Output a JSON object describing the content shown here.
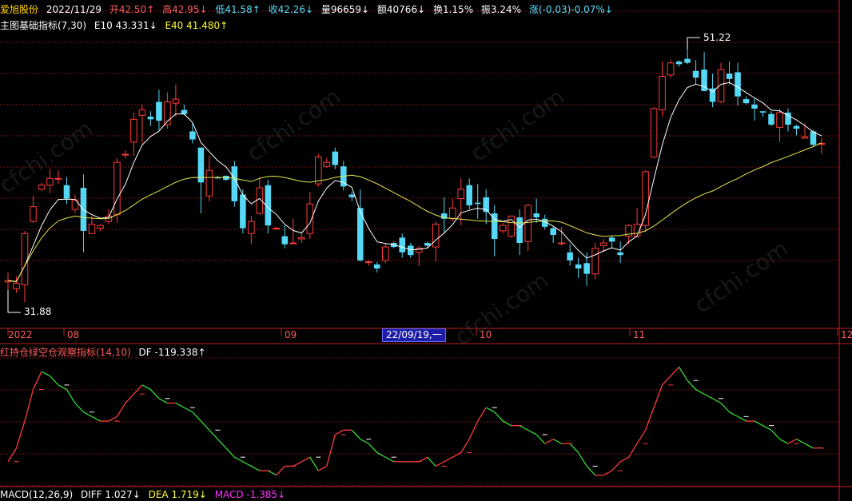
{
  "header": {
    "stock_name": "爱旭股份",
    "date": "2022/11/29",
    "open": "开42.50↑",
    "high": "高42.95↓",
    "low": "低41.58↑",
    "close": "收42.26↓",
    "volume": "量96659↓",
    "amount": "额40766↓",
    "turnover": "换1.15%",
    "amplitude": "振3.24%",
    "change": "涨(-0.03)-0.07%↓"
  },
  "indicator": {
    "name": "主图基础指标(7,30)",
    "e10": "E10 43.331↓",
    "e40": "E40 41.480↑"
  },
  "price_markers": {
    "high": "51.22",
    "low": "31.88"
  },
  "x_axis": {
    "labels": [
      "2022",
      "08",
      "09",
      "10",
      "11",
      "12"
    ],
    "crosshair_date": "22/09/19,一"
  },
  "sub_indicator": {
    "name": "红持仓绿空仓观察指标(14,10)",
    "df": "DF -119.338↑"
  },
  "macd": {
    "name": "MACD(12,26,9)",
    "diff": "DIFF 1.027↓",
    "dea": "DEA 1.719↓",
    "macd": "MACD -1.385↓"
  },
  "watermark_text": "cfchi.com",
  "colors": {
    "up": "#ff3b3b",
    "down": "#54d8f5",
    "ma_short": "#ffffff",
    "ma_long": "#e6e64a",
    "grid": "#7a1010",
    "axis": "#c02020"
  },
  "chart_data": {
    "type": "candlestick",
    "candles": [
      {
        "o": 33.9,
        "h": 34.6,
        "l": 33.3,
        "c": 34.0
      },
      {
        "o": 33.4,
        "h": 34.3,
        "l": 33.1,
        "c": 33.8
      },
      {
        "o": 33.7,
        "h": 37.7,
        "l": 32.4,
        "c": 37.5
      },
      {
        "o": 38.4,
        "h": 40.3,
        "l": 38.3,
        "c": 39.5
      },
      {
        "o": 40.8,
        "h": 41.3,
        "l": 40.7,
        "c": 41.1
      },
      {
        "o": 41.1,
        "h": 42.3,
        "l": 40.5,
        "c": 41.6
      },
      {
        "o": 41.6,
        "h": 42.2,
        "l": 41.2,
        "c": 41.6
      },
      {
        "o": 41.1,
        "h": 41.7,
        "l": 39.7,
        "c": 40.1
      },
      {
        "o": 39.3,
        "h": 40.4,
        "l": 39.0,
        "c": 40.0
      },
      {
        "o": 40.9,
        "h": 41.9,
        "l": 36.1,
        "c": 37.7
      },
      {
        "o": 37.5,
        "h": 38.8,
        "l": 37.5,
        "c": 38.2
      },
      {
        "o": 37.9,
        "h": 38.2,
        "l": 37.7,
        "c": 38.1
      },
      {
        "o": 38.4,
        "h": 39.3,
        "l": 38.2,
        "c": 38.8
      },
      {
        "o": 38.9,
        "h": 43.1,
        "l": 38.3,
        "c": 42.8
      },
      {
        "o": 43.4,
        "h": 43.7,
        "l": 43.1,
        "c": 43.4
      },
      {
        "o": 44.3,
        "h": 46.5,
        "l": 43.3,
        "c": 46.0
      },
      {
        "o": 46.3,
        "h": 47.1,
        "l": 44.2,
        "c": 46.7
      },
      {
        "o": 46.2,
        "h": 46.6,
        "l": 45.5,
        "c": 46.0
      },
      {
        "o": 47.3,
        "h": 48.2,
        "l": 45.2,
        "c": 45.9
      },
      {
        "o": 45.6,
        "h": 48.0,
        "l": 45.3,
        "c": 47.3
      },
      {
        "o": 47.2,
        "h": 48.6,
        "l": 46.2,
        "c": 47.5
      },
      {
        "o": 46.7,
        "h": 47.1,
        "l": 46.3,
        "c": 46.4
      },
      {
        "o": 45.1,
        "h": 45.7,
        "l": 44.2,
        "c": 44.5
      },
      {
        "o": 43.9,
        "h": 43.9,
        "l": 39.0,
        "c": 41.3
      },
      {
        "o": 40.3,
        "h": 43.3,
        "l": 39.9,
        "c": 42.2
      },
      {
        "o": 41.7,
        "h": 41.8,
        "l": 41.6,
        "c": 41.6
      },
      {
        "o": 41.8,
        "h": 41.8,
        "l": 41.4,
        "c": 41.5
      },
      {
        "o": 42.5,
        "h": 42.9,
        "l": 39.5,
        "c": 39.9
      },
      {
        "o": 40.4,
        "h": 40.8,
        "l": 37.5,
        "c": 37.9
      },
      {
        "o": 37.5,
        "h": 38.8,
        "l": 36.7,
        "c": 38.4
      },
      {
        "o": 39.0,
        "h": 41.7,
        "l": 38.9,
        "c": 40.9
      },
      {
        "o": 41.1,
        "h": 41.5,
        "l": 37.5,
        "c": 38.1
      },
      {
        "o": 37.9,
        "h": 38.0,
        "l": 37.8,
        "c": 37.9
      },
      {
        "o": 37.3,
        "h": 38.1,
        "l": 36.4,
        "c": 36.7
      },
      {
        "o": 36.8,
        "h": 38.6,
        "l": 36.7,
        "c": 36.8
      },
      {
        "o": 37.1,
        "h": 37.6,
        "l": 36.8,
        "c": 37.2
      },
      {
        "o": 37.5,
        "h": 40.6,
        "l": 37.1,
        "c": 39.7
      },
      {
        "o": 41.2,
        "h": 43.4,
        "l": 41.0,
        "c": 43.2
      },
      {
        "o": 42.5,
        "h": 43.1,
        "l": 42.4,
        "c": 42.8
      },
      {
        "o": 43.6,
        "h": 43.9,
        "l": 42.3,
        "c": 42.6
      },
      {
        "o": 42.5,
        "h": 42.9,
        "l": 40.7,
        "c": 41.0
      },
      {
        "o": 40.4,
        "h": 40.6,
        "l": 39.9,
        "c": 40.2
      },
      {
        "o": 39.4,
        "h": 40.8,
        "l": 35.4,
        "c": 35.5
      },
      {
        "o": 35.4,
        "h": 35.5,
        "l": 35.1,
        "c": 35.4
      },
      {
        "o": 35.2,
        "h": 35.4,
        "l": 34.6,
        "c": 34.9
      },
      {
        "o": 35.5,
        "h": 36.8,
        "l": 35.3,
        "c": 36.5
      },
      {
        "o": 36.8,
        "h": 36.9,
        "l": 36.4,
        "c": 36.5
      },
      {
        "o": 37.2,
        "h": 37.5,
        "l": 35.7,
        "c": 36.1
      },
      {
        "o": 36.6,
        "h": 36.8,
        "l": 35.7,
        "c": 35.9
      },
      {
        "o": 36.1,
        "h": 36.6,
        "l": 35.1,
        "c": 36.4
      },
      {
        "o": 36.8,
        "h": 36.9,
        "l": 36.4,
        "c": 36.6
      },
      {
        "o": 36.5,
        "h": 38.4,
        "l": 35.4,
        "c": 38.2
      },
      {
        "o": 39.0,
        "h": 40.2,
        "l": 37.5,
        "c": 38.6
      },
      {
        "o": 38.6,
        "h": 40.1,
        "l": 38.4,
        "c": 39.4
      },
      {
        "o": 40.1,
        "h": 41.6,
        "l": 38.1,
        "c": 40.8
      },
      {
        "o": 41.1,
        "h": 41.6,
        "l": 39.3,
        "c": 39.6
      },
      {
        "o": 39.8,
        "h": 41.2,
        "l": 38.6,
        "c": 39.7
      },
      {
        "o": 40.2,
        "h": 40.8,
        "l": 38.2,
        "c": 39.1
      },
      {
        "o": 39.0,
        "h": 39.6,
        "l": 35.8,
        "c": 37.1
      },
      {
        "o": 37.7,
        "h": 38.3,
        "l": 37.5,
        "c": 38.1
      },
      {
        "o": 37.3,
        "h": 38.8,
        "l": 37.2,
        "c": 38.8
      },
      {
        "o": 38.7,
        "h": 39.3,
        "l": 35.9,
        "c": 36.8
      },
      {
        "o": 36.9,
        "h": 39.7,
        "l": 36.2,
        "c": 39.6
      },
      {
        "o": 39.0,
        "h": 40.1,
        "l": 38.3,
        "c": 38.7
      },
      {
        "o": 38.6,
        "h": 38.9,
        "l": 37.8,
        "c": 38.0
      },
      {
        "o": 37.9,
        "h": 38.0,
        "l": 36.8,
        "c": 37.4
      },
      {
        "o": 36.8,
        "h": 38.0,
        "l": 36.6,
        "c": 36.8
      },
      {
        "o": 36.1,
        "h": 36.7,
        "l": 35.1,
        "c": 35.5
      },
      {
        "o": 35.2,
        "h": 35.7,
        "l": 34.2,
        "c": 34.9
      },
      {
        "o": 35.3,
        "h": 36.1,
        "l": 33.6,
        "c": 34.5
      },
      {
        "o": 34.5,
        "h": 36.8,
        "l": 34.1,
        "c": 36.4
      },
      {
        "o": 36.6,
        "h": 37.1,
        "l": 36.1,
        "c": 36.8
      },
      {
        "o": 37.2,
        "h": 37.3,
        "l": 36.4,
        "c": 36.9
      },
      {
        "o": 36.1,
        "h": 36.9,
        "l": 35.3,
        "c": 35.9
      },
      {
        "o": 37.3,
        "h": 38.2,
        "l": 36.7,
        "c": 38.1
      },
      {
        "o": 37.3,
        "h": 39.4,
        "l": 37.2,
        "c": 38.2
      },
      {
        "o": 38.1,
        "h": 42.2,
        "l": 37.6,
        "c": 42.1
      },
      {
        "o": 43.2,
        "h": 46.9,
        "l": 43.1,
        "c": 46.8
      },
      {
        "o": 46.7,
        "h": 50.3,
        "l": 46.2,
        "c": 49.2
      },
      {
        "o": 49.3,
        "h": 50.4,
        "l": 49.1,
        "c": 50.2
      },
      {
        "o": 50.3,
        "h": 50.4,
        "l": 49.9,
        "c": 50.1
      },
      {
        "o": 50.5,
        "h": 51.22,
        "l": 50.1,
        "c": 50.2
      },
      {
        "o": 49.6,
        "h": 50.4,
        "l": 48.6,
        "c": 49.1
      },
      {
        "o": 49.7,
        "h": 51.0,
        "l": 48.2,
        "c": 48.1
      },
      {
        "o": 48.3,
        "h": 49.4,
        "l": 46.9,
        "c": 47.3
      },
      {
        "o": 47.3,
        "h": 50.2,
        "l": 47.2,
        "c": 49.7
      },
      {
        "o": 49.4,
        "h": 50.3,
        "l": 48.6,
        "c": 49.0
      },
      {
        "o": 49.5,
        "h": 50.2,
        "l": 47.0,
        "c": 47.7
      },
      {
        "o": 47.5,
        "h": 47.7,
        "l": 47.1,
        "c": 47.2
      },
      {
        "o": 47.1,
        "h": 47.6,
        "l": 45.9,
        "c": 46.8
      },
      {
        "o": 46.6,
        "h": 46.6,
        "l": 46.2,
        "c": 46.5
      },
      {
        "o": 46.4,
        "h": 46.6,
        "l": 45.5,
        "c": 45.6
      },
      {
        "o": 45.4,
        "h": 46.8,
        "l": 44.3,
        "c": 46.5
      },
      {
        "o": 46.5,
        "h": 46.8,
        "l": 45.1,
        "c": 45.6
      },
      {
        "o": 45.5,
        "h": 45.6,
        "l": 44.8,
        "c": 45.3
      },
      {
        "o": 44.6,
        "h": 45.7,
        "l": 44.6,
        "c": 44.7
      },
      {
        "o": 45.1,
        "h": 45.2,
        "l": 44.0,
        "c": 44.1
      },
      {
        "o": 44.2,
        "h": 44.6,
        "l": 43.4,
        "c": 44.2
      }
    ],
    "observation_indicator": {
      "values": [
        -150,
        -120,
        -60,
        10,
        50,
        40,
        20,
        10,
        -20,
        -40,
        -50,
        -60,
        -60,
        -50,
        -20,
        0,
        20,
        10,
        -10,
        -20,
        -20,
        -30,
        -40,
        -60,
        -80,
        -100,
        -120,
        -140,
        -150,
        -160,
        -170,
        -170,
        -180,
        -160,
        -160,
        -150,
        -140,
        -170,
        -160,
        -90,
        -80,
        -80,
        -100,
        -110,
        -130,
        -140,
        -150,
        -150,
        -150,
        -150,
        -140,
        -160,
        -150,
        -140,
        -130,
        -100,
        -60,
        -30,
        -40,
        -60,
        -70,
        -70,
        -80,
        -90,
        -110,
        -100,
        -110,
        -110,
        -130,
        -160,
        -180,
        -180,
        -170,
        -150,
        -140,
        -110,
        -80,
        -30,
        20,
        40,
        60,
        30,
        10,
        0,
        -10,
        -20,
        -40,
        -50,
        -60,
        -60,
        -70,
        -80,
        -100,
        -110,
        -100,
        -110,
        -120,
        -119.338
      ],
      "signal": [
        -150,
        -150,
        -120,
        -60,
        10,
        50,
        40,
        20,
        10,
        -20,
        -40,
        -50,
        -60,
        -60,
        -50,
        -20,
        0,
        20,
        10,
        -10,
        -20,
        -20,
        -30,
        -40,
        -60,
        -80,
        -100,
        -120,
        -140,
        -150,
        -160,
        -170,
        -170,
        -180,
        -160,
        -160,
        -150,
        -140,
        -170,
        -160,
        -90,
        -80,
        -80,
        -100,
        -110,
        -130,
        -140,
        -150,
        -150,
        -150,
        -150,
        -140,
        -160,
        -150,
        -140,
        -130,
        -100,
        -60,
        -30,
        -40,
        -60,
        -70,
        -70,
        -80,
        -90,
        -110,
        -100,
        -110,
        -110,
        -130,
        -160,
        -180,
        -180,
        -170,
        -150,
        -140,
        -110,
        -80,
        -30,
        20,
        40,
        60,
        30,
        10,
        0,
        -10,
        -20,
        -40,
        -50,
        -60,
        -60,
        -70,
        -80,
        -100,
        -110,
        -100,
        -110,
        -120
      ]
    }
  }
}
